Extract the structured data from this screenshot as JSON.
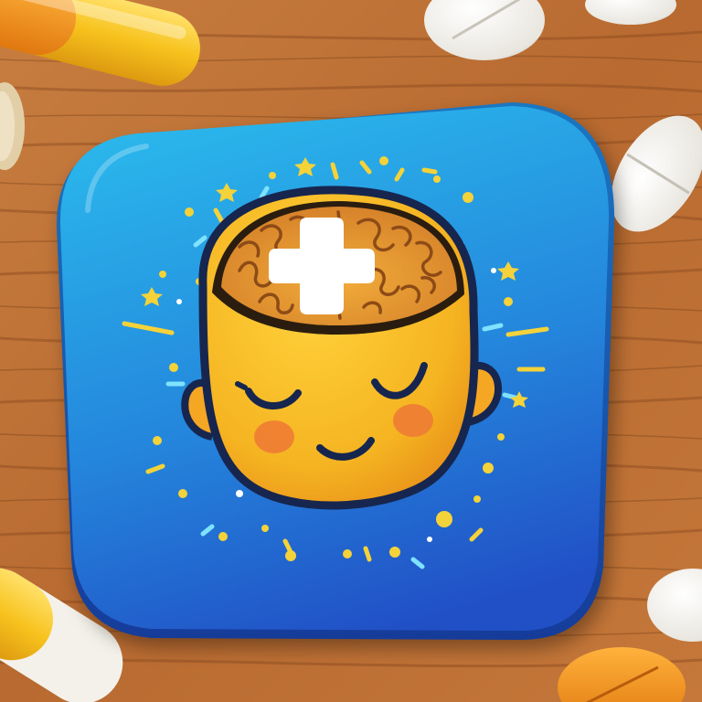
{
  "scene": {
    "background": "wooden-table",
    "subject": "app-icon",
    "icon_concept": "brain-health",
    "icon_elements": [
      "brain-icon",
      "medical-cross-icon",
      "smiling-face",
      "sparkle-dots"
    ],
    "props": [
      "capsule-pill",
      "round-tablet",
      "oval-tablet"
    ]
  },
  "colors": {
    "wood_light": "#c5793c",
    "wood_dark": "#8a4a1e",
    "tile_top": "#2bb5ea",
    "tile_bottom": "#2253c9",
    "face": "#f6bb22",
    "face_shadow": "#e48d1a",
    "brain": "#e4962c",
    "brain_line": "#8d4b16",
    "outline": "#17264e",
    "cheek": "#ee7c34",
    "cross": "#ffffff",
    "sparkle_yellow": "#f4d23a",
    "sparkle_cyan": "#7fe2ff",
    "pill_orange": "#f09a1e",
    "pill_yellow": "#f7c21d",
    "tablet_white": "#f3f1ec"
  }
}
